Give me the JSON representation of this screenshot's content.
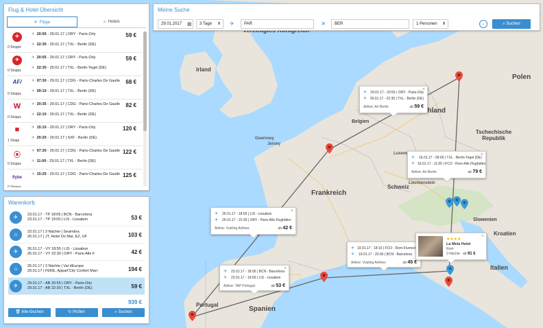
{
  "left_panel": {
    "title": "Flug & Hotel Übersicht",
    "tabs": [
      {
        "label": "Flüge",
        "icon": "airplane-icon",
        "active": true
      },
      {
        "label": "Hotels",
        "icon": "home-icon",
        "active": false
      }
    ],
    "flights": [
      {
        "airline_logo": "logo-red-swirl",
        "stops": "0 Stopps",
        "price": "59 €",
        "out": {
          "time": "20:55",
          "date": "29.01.17",
          "route": "ORY - Paris-Orly"
        },
        "ret": {
          "time": "22:30",
          "date": "29.01.17",
          "route": "TXL - Berlin (DE)"
        }
      },
      {
        "airline_logo": "logo-red-swirl",
        "stops": "0 Stopps",
        "price": "59 €",
        "out": {
          "time": "20:55",
          "date": "29.01.17",
          "route": "ORY - Paris-Orly"
        },
        "ret": {
          "time": "22:30",
          "date": "29.01.17",
          "route": "TXL - Berlin-Tegel (DE)"
        }
      },
      {
        "airline_logo": "AF",
        "stops": "0 Stopps",
        "price": "68 €",
        "out": {
          "time": "07:30",
          "date": "29.01.17",
          "route": "CDG - Paris-Charles De Gaulle"
        },
        "ret": {
          "time": "09:10",
          "date": "29.01.17",
          "route": "TXL - Berlin (DE)"
        }
      },
      {
        "airline_logo": "W",
        "stops": "0 Stopps",
        "price": "82 €",
        "out": {
          "time": "20:35",
          "date": "29.01.17",
          "route": "CDG - Paris-Charles De Gaulle"
        },
        "ret": {
          "time": "22:10",
          "date": "29.01.17",
          "route": "TXL - Berlin (DE)"
        }
      },
      {
        "airline_logo": "logo-red-box",
        "stops": "1 Stopp",
        "price": "120 €",
        "out": {
          "time": "15:10",
          "date": "29.01.17",
          "route": "ORY - Paris-Orly"
        },
        "ret": {
          "time": "20:20",
          "date": "29.01.17",
          "route": "SXF - Berlin (DE)"
        }
      },
      {
        "airline_logo": "logo-red-drop",
        "stops": "0 Stopps",
        "price": "122 €",
        "out": {
          "time": "07:30",
          "date": "29.01.17",
          "route": "CDG - Paris-Charles De Gaulle"
        },
        "ret": {
          "time": "11:00",
          "date": "29.01.17",
          "route": "TXL - Berlin (DE)"
        }
      },
      {
        "airline_logo": "flybe",
        "stops": "0 Stopps",
        "price": "125 €",
        "out": {
          "time": "15:25",
          "date": "29.01.17",
          "route": "CDG - Paris-Charles De Gaulle"
        },
        "ret": {
          "time": "",
          "date": "",
          "route": ""
        }
      }
    ]
  },
  "cart": {
    "title": "Warenkorb",
    "items": [
      {
        "icon": "airplane-icon",
        "line1": "23.01.17 - TP 18:05 | BCN - Barcelona",
        "line2": "23.01.17 - TP 19:00 | LIS - Lissabon",
        "price": "53 €",
        "selected": false
      },
      {
        "icon": "home-icon",
        "line1": "23.01.17 | 3 Nächte | Sesimbra",
        "line2": "26.01.17 | JT, Hotel Do Mar, EZ, UF",
        "price": "103 €",
        "selected": false
      },
      {
        "icon": "airplane-icon",
        "line1": "26.01.17 - VY 18:55 | LIS - Lissabon",
        "line2": "26.01.17 - VY 22:30 | ORY - Paris-Alle F",
        "price": "42 €",
        "selected": false
      },
      {
        "icon": "home-icon",
        "line1": "26.01.17 | 3 Nächte | Val dEurope",
        "line2": "29.01.17 | FERE, Appart'City Confort Marr",
        "price": "194 €",
        "selected": false
      },
      {
        "icon": "airplane-icon",
        "line1": "29.01.17 - AB 20:55 | ORY - Paris-Orly",
        "line2": "29.01.17 - AB 22:30 | TXL - Berlin (DE)",
        "price": "59 €",
        "selected": true
      }
    ],
    "total": "939 €",
    "buttons": {
      "clear": "Alle löschen",
      "check": "Prüfen",
      "search": "Suchen"
    }
  },
  "search": {
    "title": "Meine Suche",
    "date": "29.01.2017",
    "duration": "3 Tage",
    "from": "PAR",
    "to": "BER",
    "persons": "1 Personen",
    "button": "Suchen"
  },
  "map": {
    "countries": {
      "uk": "Vereinigtes Königreich",
      "ireland": "Irland",
      "germany": "Deutschland",
      "france": "Frankreich",
      "spain": "Spanien",
      "portugal": "Portugal",
      "poland": "Polen",
      "czech": "Tschechische Republik",
      "belgium": "Belgien",
      "switzerland": "Schweiz",
      "slovenia": "Slowenien",
      "croatia": "Kroatien",
      "italy": "Italien",
      "luxembourg": "Luxemburg",
      "liechtenstein": "Liechtenstein",
      "jersey": "Jersey",
      "guernsey": "Guernsey"
    },
    "popups": {
      "berlin": {
        "out": "29.01.17 - 20:55 | ORY - Paris-Orly",
        "ret": "29.01.17 - 22:30 | TXL - Berlin (DE)",
        "airline": "Airline: Air Berlin",
        "price_prefix": "ab",
        "price": "59 €"
      },
      "rome": {
        "out": "16.01.17 - 09:00 | TXL - Berlin-Tegel (DE)",
        "ret": "16.01.17 - 11:05 | FCO - Rom-Alle Flughäfen",
        "airline": "Airline: Air Berlin",
        "price_prefix": "ab",
        "price": "79 €"
      },
      "paris": {
        "out": "26.01.17 - 18:55 | LIS - Lissabon",
        "ret": "26.01.17 - 22:30 | ORY - Paris-Alle Flughäfen",
        "airline": "Airline: Vueling Airlines",
        "price_prefix": "ab",
        "price": "42 €"
      },
      "barcelona": {
        "out": "19.01.17 - 18:10 | FCO - Rom-Fiumicino",
        "ret": "19.01.17 - 20:00 | BCN - Barcelona",
        "airline": "Airline: Vueling Airlines",
        "price_prefix": "ab",
        "price": "45 €"
      },
      "lisbon": {
        "out": "23.01.17 - 18:05 | BCN - Barcelona",
        "ret": "23.01.17 - 19:00 | LIS - Lissabon",
        "airline": "Airline: TAP Portugal",
        "price_prefix": "ab",
        "price": "53 €"
      },
      "hotel": {
        "name": "La Mela Hotel",
        "city": "Rom",
        "nights": "3 Nächte",
        "price_prefix": "ab",
        "price": "91 €"
      }
    }
  }
}
